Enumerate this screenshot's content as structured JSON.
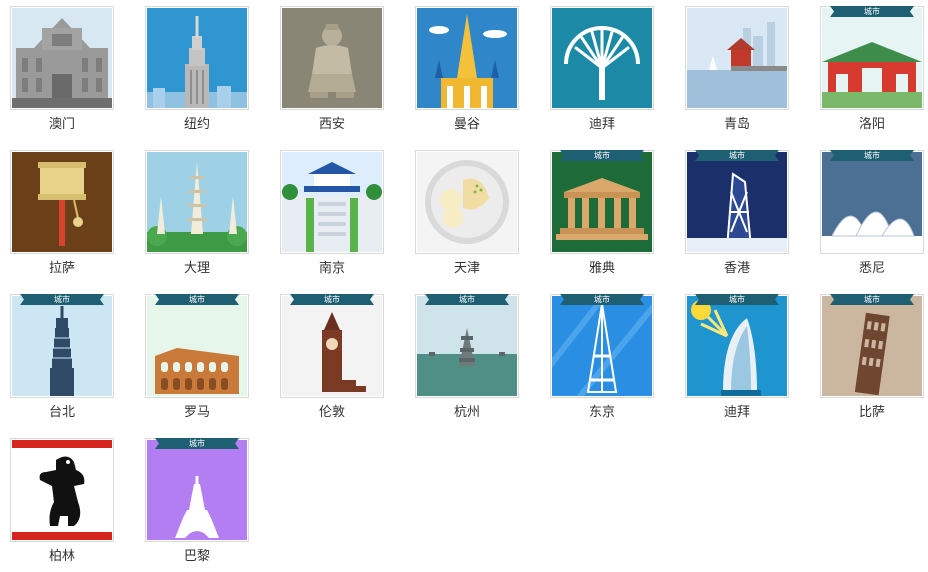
{
  "badge_text": "城市",
  "items": [
    {
      "label": "澳门",
      "icon": "macau-ruins-icon",
      "badge": false
    },
    {
      "label": "纽约",
      "icon": "empire-state-building-icon",
      "badge": false
    },
    {
      "label": "西安",
      "icon": "terracotta-warrior-icon",
      "badge": false
    },
    {
      "label": "曼谷",
      "icon": "golden-pagoda-icon",
      "badge": false
    },
    {
      "label": "迪拜",
      "icon": "palm-island-icon",
      "badge": false
    },
    {
      "label": "青岛",
      "icon": "qingdao-pier-icon",
      "badge": false
    },
    {
      "label": "洛阳",
      "icon": "luoyang-gate-icon",
      "badge": true
    },
    {
      "label": "拉萨",
      "icon": "prayer-wheel-icon",
      "badge": false
    },
    {
      "label": "大理",
      "icon": "three-pagodas-icon",
      "badge": false
    },
    {
      "label": "南京",
      "icon": "sun-yatsen-mausoleum-icon",
      "badge": false
    },
    {
      "label": "天津",
      "icon": "dumplings-icon",
      "badge": false
    },
    {
      "label": "雅典",
      "icon": "parthenon-icon",
      "badge": true
    },
    {
      "label": "香港",
      "icon": "bank-of-china-tower-icon",
      "badge": true
    },
    {
      "label": "悉尼",
      "icon": "opera-house-icon",
      "badge": true
    },
    {
      "label": "台北",
      "icon": "taipei-101-icon",
      "badge": true
    },
    {
      "label": "罗马",
      "icon": "colosseum-icon",
      "badge": true
    },
    {
      "label": "伦敦",
      "icon": "big-ben-icon",
      "badge": true
    },
    {
      "label": "杭州",
      "icon": "three-pools-pagoda-icon",
      "badge": true
    },
    {
      "label": "东京",
      "icon": "tokyo-tower-icon",
      "badge": true
    },
    {
      "label": "迪拜",
      "icon": "burj-al-arab-icon",
      "badge": true
    },
    {
      "label": "比萨",
      "icon": "leaning-tower-icon",
      "badge": true
    },
    {
      "label": "柏林",
      "icon": "berlin-bear-icon",
      "badge": false
    },
    {
      "label": "巴黎",
      "icon": "eiffel-tower-icon",
      "badge": true
    }
  ]
}
